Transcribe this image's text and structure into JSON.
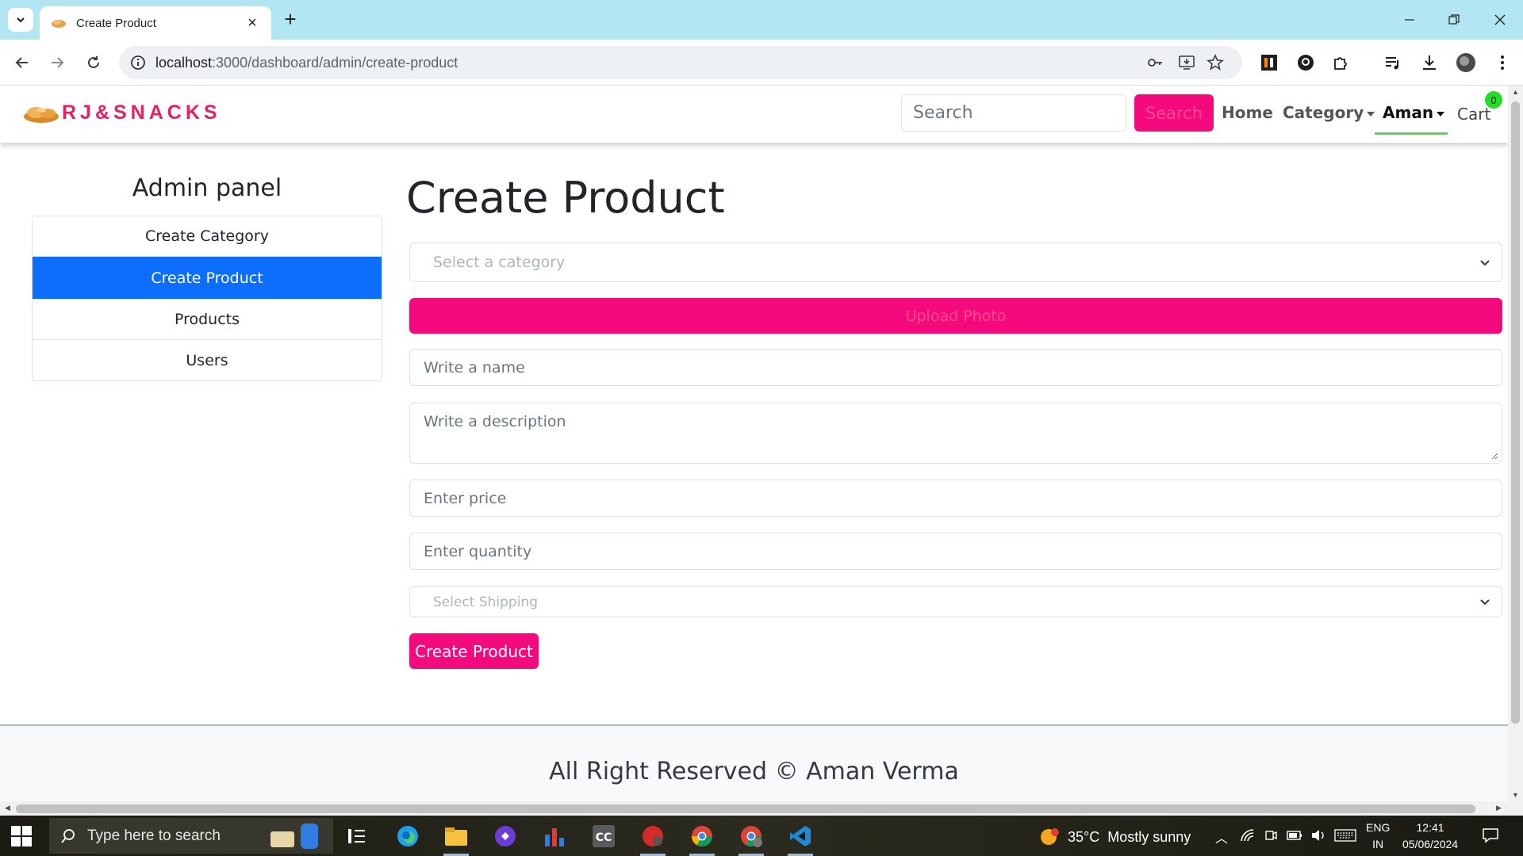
{
  "browser": {
    "tab_title": "Create Product",
    "url_host": "localhost",
    "url_rest": ":3000/dashboard/admin/create-product"
  },
  "navbar": {
    "brand": "RJ&SNACKS",
    "search_placeholder": "Search",
    "search_button": "Search",
    "home": "Home",
    "category": "Category",
    "user": "Aman",
    "cart": "Cart",
    "cart_count": "0"
  },
  "sidebar": {
    "title": "Admin panel",
    "items": [
      {
        "label": "Create Category"
      },
      {
        "label": "Create Product"
      },
      {
        "label": "Products"
      },
      {
        "label": "Users"
      }
    ]
  },
  "form": {
    "heading": "Create Product",
    "category_placeholder": "Select a category",
    "upload_label": "Upload Photo",
    "name_placeholder": "Write a name",
    "description_placeholder": "Write a description",
    "price_placeholder": "Enter price",
    "quantity_placeholder": "Enter quantity",
    "shipping_placeholder": "Select Shipping",
    "submit_label": "Create Product"
  },
  "footer": {
    "text": "All Right Reserved © Aman Verma"
  },
  "taskbar": {
    "search_placeholder": "Type here to search",
    "weather_temp": "35°C",
    "weather_desc": "Mostly sunny",
    "lang_top": "ENG",
    "lang_bottom": "IN",
    "time": "12:41",
    "date": "05/06/2024"
  },
  "colors": {
    "brand_pink": "#e91e63",
    "button_pink": "#f50a7e",
    "active_blue": "#0d6efd",
    "badge_green": "#22dd22"
  }
}
